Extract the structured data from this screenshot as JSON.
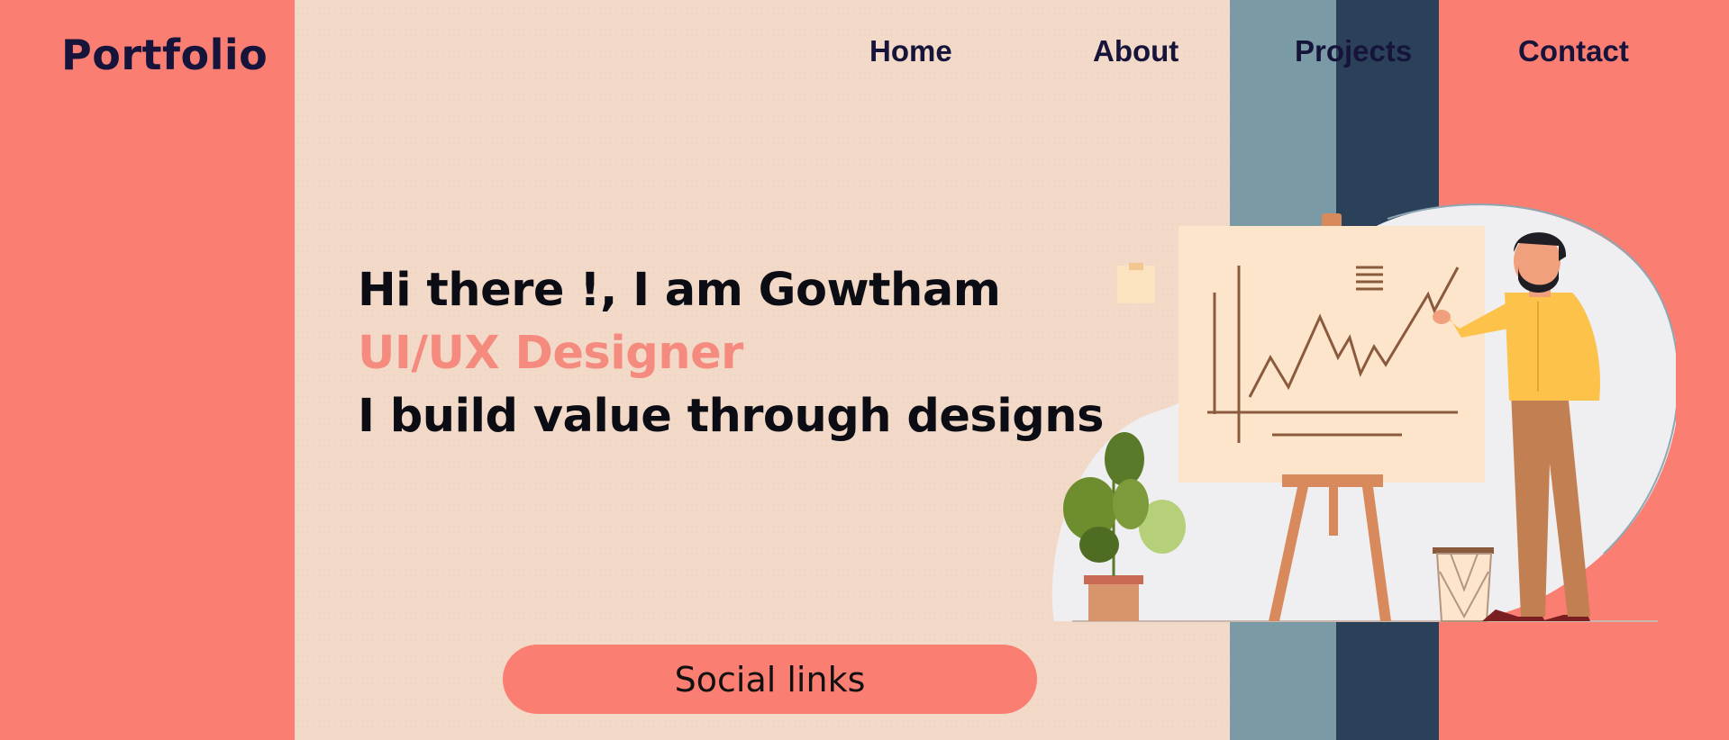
{
  "header": {
    "logo": "Portfolio",
    "nav": [
      {
        "label": "Home"
      },
      {
        "label": "About"
      },
      {
        "label": "Projects"
      },
      {
        "label": "Contact"
      }
    ]
  },
  "hero": {
    "greeting": "Hi there !, I am Gowtham",
    "role": "UI/UX Designer",
    "tagline": "I build value through designs"
  },
  "cta": {
    "social_label": "Social links"
  },
  "colors": {
    "coral": "#fa7e72",
    "paper": "#f2d9c8",
    "teal": "#7a9aa6",
    "navy": "#2b4159",
    "text_dark": "#16143a",
    "role_accent": "#f58a7e"
  },
  "icons": {
    "illustration": "presenter-with-chart-illustration"
  }
}
